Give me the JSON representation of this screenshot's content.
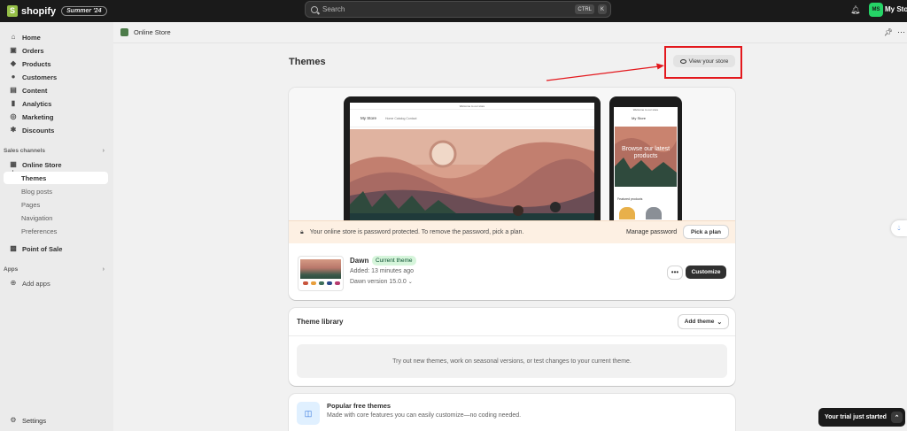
{
  "topbar": {
    "brand": "shopify",
    "edition_badge": "Summer '24",
    "search_placeholder": "Search",
    "shortcut_ctrl": "CTRL",
    "shortcut_key": "K",
    "store_initials": "MS",
    "store_name": "My Store"
  },
  "sidebar": {
    "main_items": [
      {
        "label": "Home",
        "icon": "home-icon"
      },
      {
        "label": "Orders",
        "icon": "orders-icon"
      },
      {
        "label": "Products",
        "icon": "tag-icon"
      },
      {
        "label": "Customers",
        "icon": "person-icon"
      },
      {
        "label": "Content",
        "icon": "content-icon"
      },
      {
        "label": "Analytics",
        "icon": "chart-icon"
      },
      {
        "label": "Marketing",
        "icon": "target-icon"
      },
      {
        "label": "Discounts",
        "icon": "discount-icon"
      }
    ],
    "sales_channels_label": "Sales channels",
    "online_store_label": "Online Store",
    "online_store_sub": [
      "Themes",
      "Blog posts",
      "Pages",
      "Navigation",
      "Preferences"
    ],
    "point_of_sale_label": "Point of Sale",
    "apps_label": "Apps",
    "add_apps_label": "Add apps",
    "settings_label": "Settings"
  },
  "breadcrumb": {
    "label": "Online Store"
  },
  "page": {
    "title": "Themes",
    "view_store_label": "View your store"
  },
  "current_theme": {
    "preview_announcement": "Welcome to our store",
    "preview_store_name": "My Store",
    "preview_nav": "Home   Catalog   Contact",
    "phone_hero_text": "Browse our latest products",
    "phone_featured": "Featured products",
    "banner_text": "Your online store is password protected. To remove the password, pick a plan.",
    "manage_password_label": "Manage password",
    "pick_plan_label": "Pick a plan",
    "name": "Dawn",
    "badge": "Current theme",
    "added": "Added: 13 minutes ago",
    "version": "Dawn version 15.0.0",
    "more_label": "•••",
    "customize_label": "Customize"
  },
  "library": {
    "title": "Theme library",
    "add_theme_label": "Add theme",
    "empty_text": "Try out new themes, work on seasonal versions, or test changes to your current theme."
  },
  "popular": {
    "title": "Popular free themes",
    "subtitle": "Made with core features you can easily customize—no coding needed."
  },
  "trial": {
    "label": "Your trial just started"
  },
  "colors": {
    "topbar_bg": "#1a1a1a",
    "highlight_red": "#e3181d",
    "badge_green": "#d6f5db",
    "banner_bg": "#fdf0e3"
  }
}
